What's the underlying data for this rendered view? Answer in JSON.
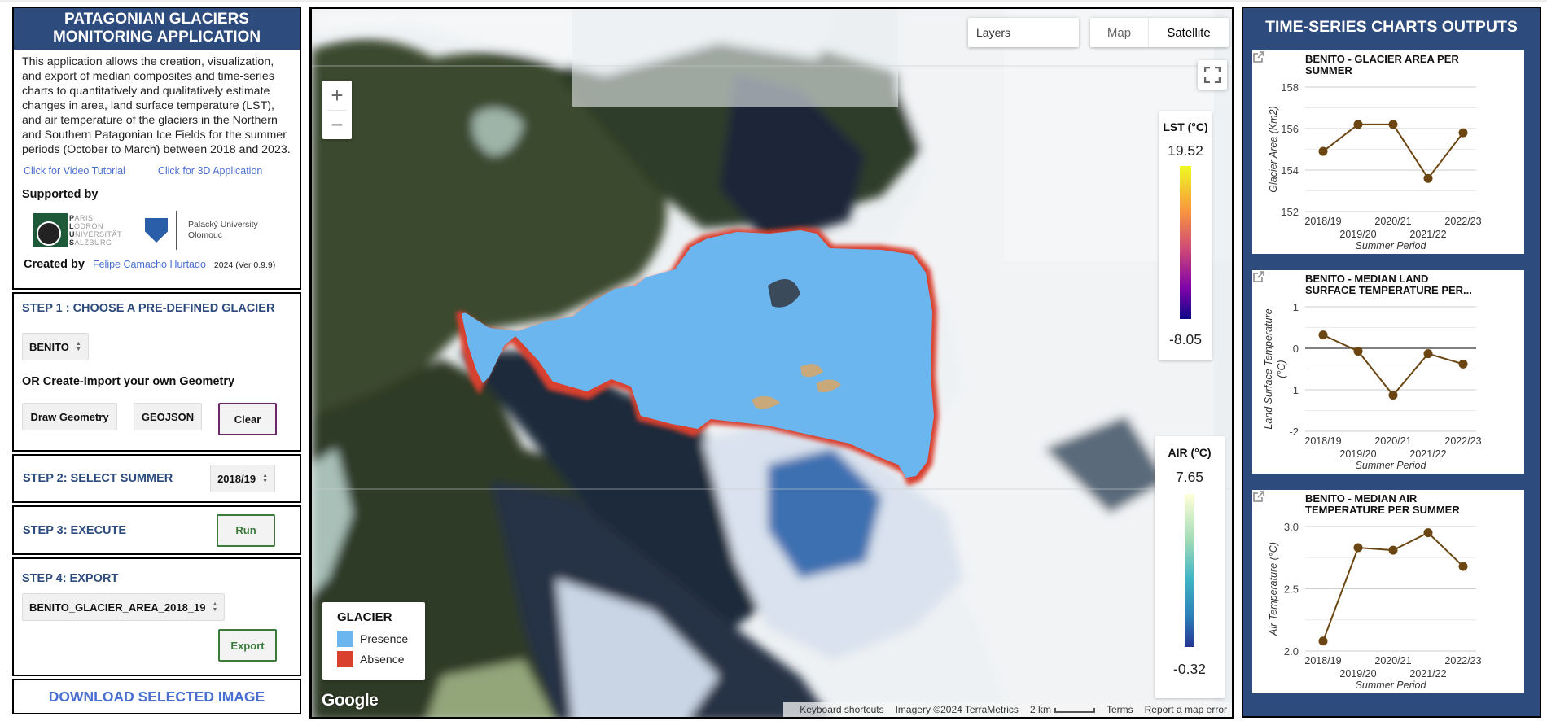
{
  "left_panel": {
    "title": "PATAGONIAN GLACIERS MONITORING APPLICATION",
    "description": "This application allows the creation, visualization, and export of median composites and time-series charts to quantitatively and qualitatively estimate changes in area, land surface temperature (LST), and air temperature of the glaciers in the Northern and Southern Patagonian Ice Fields for the summer periods (October to March) between 2018 and 2023.",
    "video_link": "Click for Video Tutorial",
    "app3d_link": "Click for 3D Application",
    "supported_by": "Supported by",
    "plus_logo_lines": [
      "ARIS",
      "ODRON",
      "NIVERSITÄT",
      "ALZBURG"
    ],
    "plus_logo_initials": [
      "P",
      "L",
      "U",
      "S"
    ],
    "upol_logo_lines": [
      "Palacký University",
      "Olomouc"
    ],
    "created_by_label": "Created by",
    "author": "Felipe Camacho Hurtado",
    "version": "2024 (Ver 0.9.9)",
    "step1": {
      "title": "STEP 1 : CHOOSE A PRE-DEFINED GLACIER",
      "glacier_select": "BENITO",
      "or_label": "OR Create-Import your own Geometry",
      "draw_button": "Draw Geometry",
      "geojson_button": "GEOJSON",
      "clear_button": "Clear"
    },
    "step2": {
      "title": "STEP 2: SELECT SUMMER",
      "summer_select": "2018/19"
    },
    "step3": {
      "title": "STEP 3: EXECUTE",
      "run_button": "Run"
    },
    "step4": {
      "title": "STEP 4: EXPORT",
      "export_select": "BENITO_GLACIER_AREA_2018_19",
      "export_button": "Export"
    },
    "download_label": "DOWNLOAD SELECTED IMAGE"
  },
  "map": {
    "layers_label": "Layers",
    "maptype_map": "Map",
    "maptype_satellite": "Satellite",
    "active_maptype": "Satellite",
    "zoom_in": "+",
    "zoom_out": "−",
    "lst_legend": {
      "title": "LST (°C)",
      "max": "19.52",
      "min": "-8.05",
      "colors": [
        "#f0f921",
        "#f89540",
        "#cc4778",
        "#7e03a8",
        "#0d0887"
      ]
    },
    "air_legend": {
      "title": "AIR (°C)",
      "max": "7.65",
      "min": "-0.32",
      "colors": [
        "#ffffd9",
        "#a3dbb7",
        "#41b6c4",
        "#2c7fb8",
        "#253494"
      ]
    },
    "glacier_legend": {
      "title": "GLACIER",
      "items": [
        {
          "label": "Presence",
          "color": "#6cb6f0"
        },
        {
          "label": "Absence",
          "color": "#d9412e"
        }
      ]
    },
    "google_logo": "Google",
    "attribution": {
      "keyboard": "Keyboard shortcuts",
      "imagery": "Imagery ©2024 TerraMetrics",
      "scale": "2 km",
      "terms": "Terms",
      "report": "Report a map error"
    }
  },
  "right_panel": {
    "title": "TIME-SERIES CHARTS OUTPUTS"
  },
  "chart_data": [
    {
      "type": "line",
      "title_lines": [
        "BENITO - GLACIER AREA PER",
        "SUMMER"
      ],
      "categories": [
        "2018/19",
        "2019/20",
        "2020/21",
        "2021/22",
        "2022/23"
      ],
      "values": [
        154.9,
        156.2,
        156.2,
        153.6,
        155.8
      ],
      "xlabel": "Summer Period",
      "ylabel": "Glacier Area (Km2)",
      "ylim": [
        152,
        158
      ],
      "yticks": [
        152,
        154,
        156,
        158
      ],
      "yticklabels": [
        "152",
        "154",
        "156",
        "158"
      ],
      "minor_grid": true,
      "zero_line": false,
      "color": "#6b4612"
    },
    {
      "type": "line",
      "title_lines": [
        "BENITO - MEDIAN LAND",
        "SURFACE TEMPERATURE PER..."
      ],
      "categories": [
        "2018/19",
        "2019/20",
        "2020/21",
        "2021/22",
        "2022/23"
      ],
      "values": [
        0.32,
        -0.07,
        -1.13,
        -0.13,
        -0.38
      ],
      "xlabel": "Summer Period",
      "ylabel": "Land Surface Temperature (°C)",
      "ylabel_lines": [
        "Land Surface Temperature",
        "(°C)"
      ],
      "ylim": [
        -2,
        1
      ],
      "yticks": [
        -2,
        -1,
        0,
        1
      ],
      "yticklabels": [
        "-2",
        "-1",
        "0",
        "1"
      ],
      "minor_grid": true,
      "zero_line": true,
      "color": "#6b4612"
    },
    {
      "type": "line",
      "title_lines": [
        "BENITO - MEDIAN AIR",
        "TEMPERATURE PER SUMMER"
      ],
      "categories": [
        "2018/19",
        "2019/20",
        "2020/21",
        "2021/22",
        "2022/23"
      ],
      "values": [
        2.08,
        2.83,
        2.81,
        2.95,
        2.68
      ],
      "xlabel": "Summer Period",
      "ylabel": "Air Temperature (°C)",
      "ylim": [
        2.0,
        3.0
      ],
      "yticks": [
        2.0,
        2.5,
        3.0
      ],
      "yticklabels": [
        "2.0",
        "2.5",
        "3.0"
      ],
      "minor_grid": true,
      "zero_line": false,
      "color": "#6b4612"
    }
  ]
}
